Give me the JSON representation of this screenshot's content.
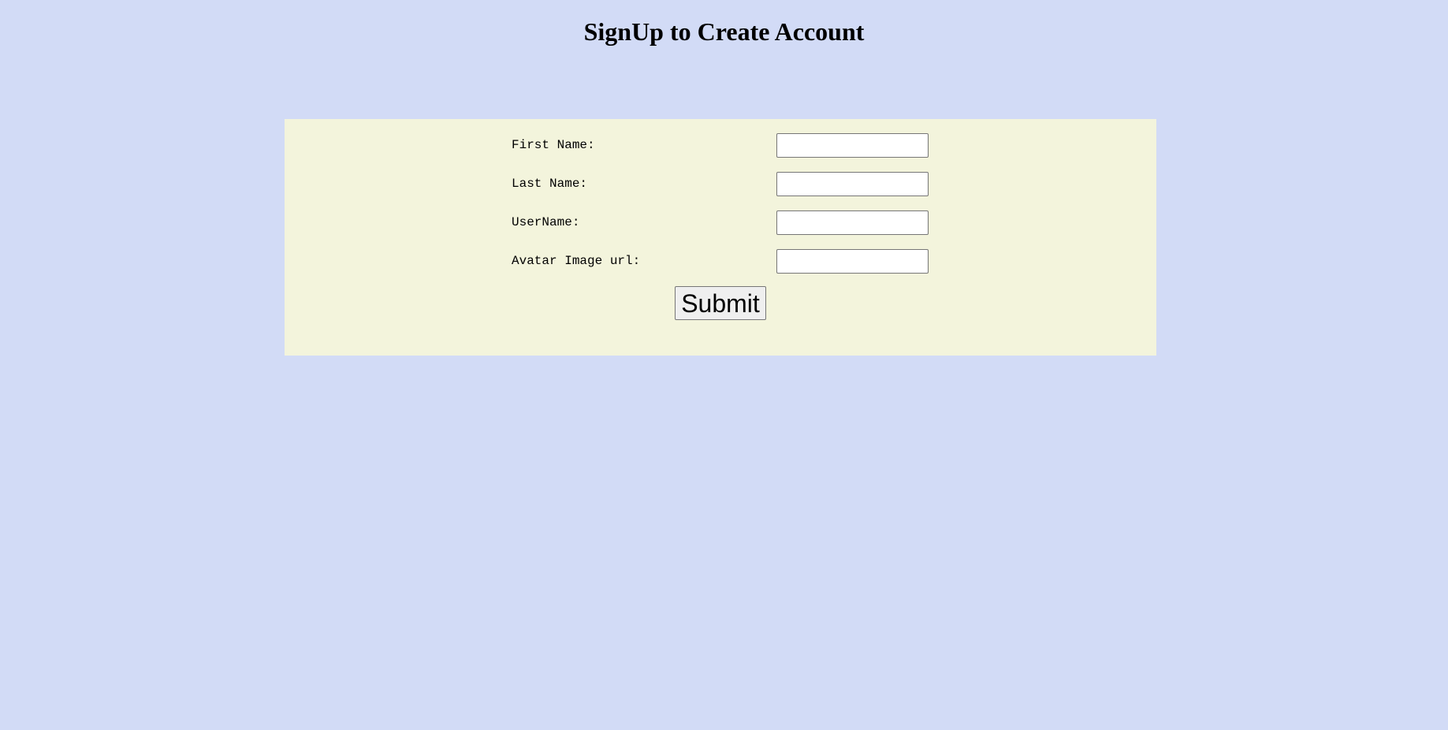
{
  "page": {
    "title": "SignUp to Create Account",
    "background_color": "#d2dbf6",
    "panel_color": "#f3f4dc"
  },
  "form": {
    "fields": [
      {
        "label": "First Name:",
        "value": "",
        "placeholder": ""
      },
      {
        "label": "Last Name:",
        "value": "",
        "placeholder": ""
      },
      {
        "label": "UserName:",
        "value": "",
        "placeholder": ""
      },
      {
        "label": "Avatar Image url:",
        "value": "",
        "placeholder": ""
      }
    ],
    "submit_label": "Submit"
  }
}
